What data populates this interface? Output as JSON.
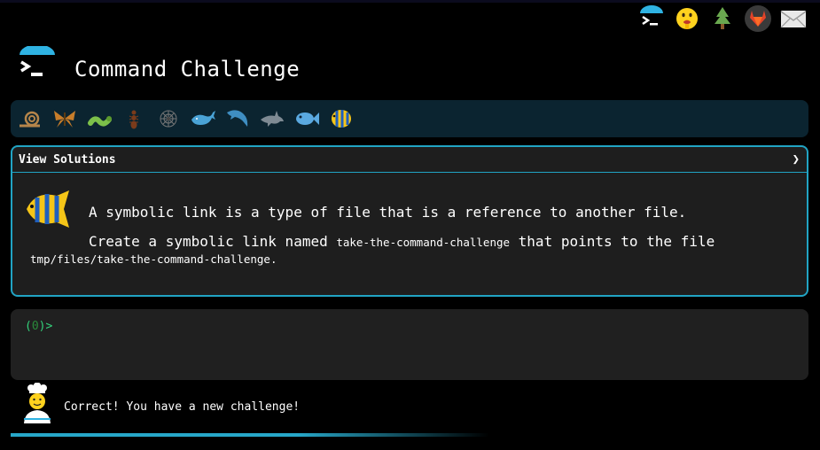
{
  "header": {
    "title": "Command Challenge"
  },
  "top_icons": [
    "terminal-icon",
    "shushing-face-icon",
    "evergreen-tree-icon",
    "gitlab-icon",
    "envelope-icon"
  ],
  "animals": [
    "snail",
    "butterfly",
    "bug",
    "ant",
    "spider",
    "whale",
    "dolphin",
    "dolphin",
    "fish",
    "tropical-fish"
  ],
  "challenge": {
    "header_label": "View Solutions",
    "expand_glyph": "❯",
    "line1": "A symbolic link is a type of file that is a reference to another file.",
    "line2_prefix": "Create a symbolic link named ",
    "line2_code": "take-the-command-challenge",
    "line2_suffix": " that points to the file",
    "line3_path": "tmp/files/take-the-command-challenge",
    "line3_suffix": "."
  },
  "terminal": {
    "prompt_open": "(",
    "prompt_status": "0",
    "prompt_close": ")>"
  },
  "status": {
    "message": "Correct! You have a new challenge!"
  },
  "progress": {
    "fraction": 0.59
  },
  "colors": {
    "accent": "#21a4c4",
    "prompt": "#33d17a",
    "animal_bar": "#0b2430"
  }
}
